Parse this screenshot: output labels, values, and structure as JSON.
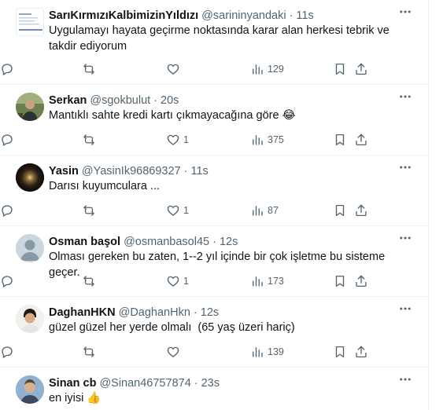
{
  "tweets": [
    {
      "name": "SarıKırmızıKalbimizinYıldızı",
      "handle": "@sarininyandaki",
      "time": "11s",
      "text": "Uygulamayı hayata geçirme noktasında karar alan herkesi tebrik ve takdir ediyorum",
      "replies": "",
      "retweets": "",
      "likes": "",
      "views": "129"
    },
    {
      "name": "Serkan",
      "handle": "@sgokbulut",
      "time": "20s",
      "text": "Mantıklı sahte kredi kartı çıkmayacağına göre",
      "emoji": "😂",
      "replies": "",
      "retweets": "",
      "likes": "1",
      "views": "375"
    },
    {
      "name": "Yasin",
      "handle": "@YasinIk96869327",
      "time": "11s",
      "text": "Darısı kuyumculara ...",
      "replies": "",
      "retweets": "",
      "likes": "1",
      "views": "87"
    },
    {
      "name": "Osman başol",
      "handle": "@osmanbasol45",
      "time": "12s",
      "text": "Olması gereken bu zaten, 1--2 yıl içinde bir çok işletme bu sisteme geçer.",
      "replies": "",
      "retweets": "",
      "likes": "1",
      "views": "173"
    },
    {
      "name": "DaghanHKN",
      "handle": "@DaghanHkn",
      "time": "12s",
      "text": "güzel güzel her yerde olmalı  (65 yaş üzeri hariç)",
      "replies": "",
      "retweets": "",
      "likes": "",
      "views": "139"
    },
    {
      "name": "Sinan cb",
      "handle": "@Sinan46757874",
      "time": "23s",
      "text": "en iyisi",
      "emoji": "👍",
      "replies": "",
      "retweets": "",
      "likes": "",
      "views": ""
    }
  ],
  "separator": "·",
  "icons": {
    "more": "more-horizontal-icon",
    "reply": "reply-icon",
    "retweet": "retweet-icon",
    "like": "heart-icon",
    "views": "views-bar-chart-icon",
    "bookmark": "bookmark-icon",
    "share": "share-icon"
  },
  "colors": {
    "text": "#0f1419",
    "secondary": "#536471",
    "border": "#eff3f4"
  }
}
